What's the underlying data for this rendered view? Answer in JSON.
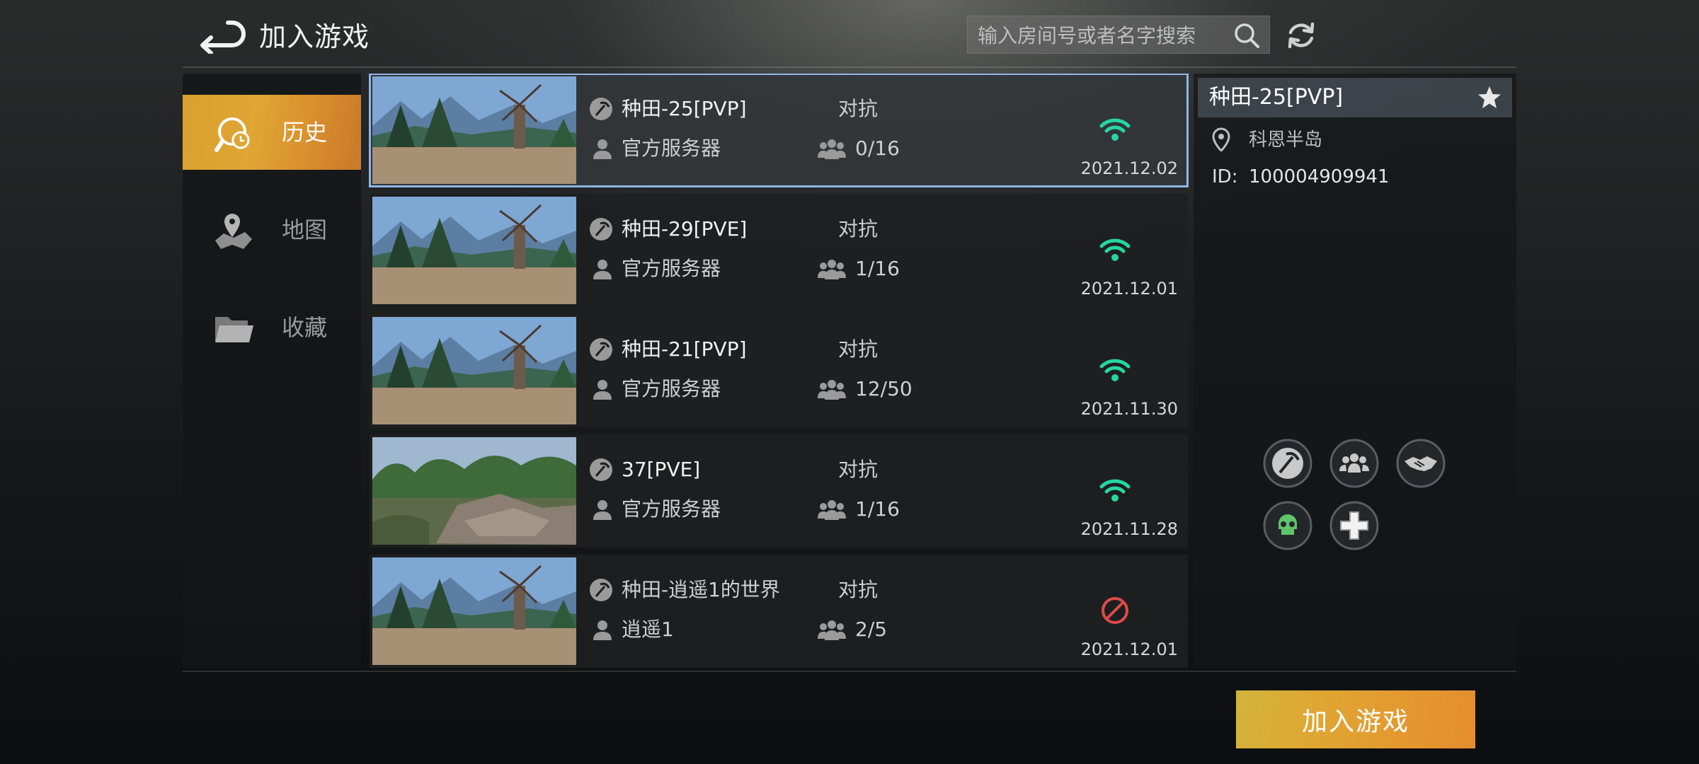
{
  "header": {
    "title": "加入游戏",
    "search_placeholder": "输入房间号或者名字搜索"
  },
  "sidebar": {
    "items": [
      {
        "label": "历史",
        "icon": "history-icon",
        "active": true
      },
      {
        "label": "地图",
        "icon": "map-icon",
        "active": false
      },
      {
        "label": "收藏",
        "icon": "folder-icon",
        "active": false
      }
    ]
  },
  "servers": [
    {
      "name": "种田-25[PVP]",
      "server": "官方服务器",
      "mode": "对抗",
      "players": "0/16",
      "status": "online",
      "date": "2021.12.02",
      "thumbnail": "windmill",
      "selected": true
    },
    {
      "name": "种田-29[PVE]",
      "server": "官方服务器",
      "mode": "对抗",
      "players": "1/16",
      "status": "online",
      "date": "2021.12.01",
      "thumbnail": "windmill",
      "selected": false
    },
    {
      "name": "种田-21[PVP]",
      "server": "官方服务器",
      "mode": "对抗",
      "players": "12/50",
      "status": "online",
      "date": "2021.11.30",
      "thumbnail": "windmill",
      "selected": false
    },
    {
      "name": "37[PVE]",
      "server": "官方服务器",
      "mode": "对抗",
      "players": "1/16",
      "status": "online",
      "date": "2021.11.28",
      "thumbnail": "forest",
      "selected": false
    },
    {
      "name": "种田-逍遥1的世界",
      "server": "逍遥1",
      "mode": "对抗",
      "players": "2/5",
      "status": "offline",
      "date": "2021.12.01",
      "thumbnail": "windmill",
      "selected": false
    }
  ],
  "detail": {
    "name": "种田-25[PVP]",
    "map": "科恩半岛",
    "id_label": "ID:",
    "id": "100004909941",
    "features": [
      "pickaxe-icon",
      "team-icon",
      "handshake-icon",
      "skull-icon",
      "medical-cross-icon"
    ]
  },
  "join_button_label": "加入游戏",
  "colors": {
    "accent_orange": "#e0a535",
    "signal_green": "#26d6a0",
    "offline_red": "#e04b4b",
    "selected_outline": "#8fb6e6"
  }
}
